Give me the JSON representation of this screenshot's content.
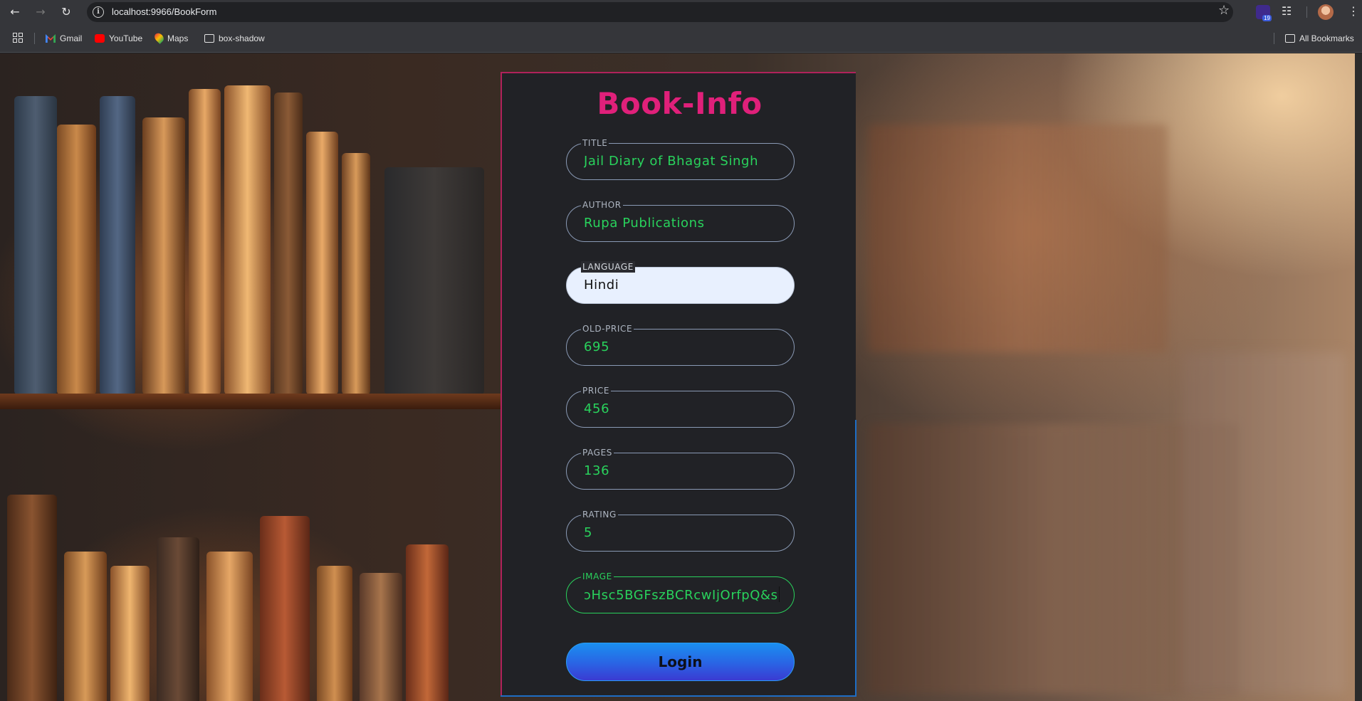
{
  "browser": {
    "url": "localhost:9966/BookForm",
    "extension_badge": "19",
    "bookmarks": [
      {
        "label": "Gmail",
        "icon": "gmail-icon"
      },
      {
        "label": "YouTube",
        "icon": "youtube-icon"
      },
      {
        "label": "Maps",
        "icon": "maps-icon"
      },
      {
        "label": "box-shadow",
        "icon": "folder-icon"
      }
    ],
    "all_bookmarks_label": "All Bookmarks"
  },
  "form": {
    "title": "Book-Info",
    "fields": [
      {
        "legend": "TITLE",
        "value": "Jail Diary of Bhagat Singh"
      },
      {
        "legend": "AUTHOR",
        "value": "Rupa Publications"
      },
      {
        "legend": "LANGUAGE",
        "value": "Hindi"
      },
      {
        "legend": "OLD-PRICE",
        "value": "695"
      },
      {
        "legend": "PRICE",
        "value": "456"
      },
      {
        "legend": "PAGES",
        "value": "136"
      },
      {
        "legend": "RATING",
        "value": "5"
      },
      {
        "legend": "IMAGE",
        "value": "ɔHsc5BGFszBCRcwIjOrfpQ&s"
      }
    ],
    "submit_label": "Login"
  },
  "colors": {
    "title": "#e0207a",
    "value_text": "#29d25c",
    "card_bg": "#212226",
    "button_top": "#1a8ff0",
    "button_bottom": "#3a3bd2"
  }
}
